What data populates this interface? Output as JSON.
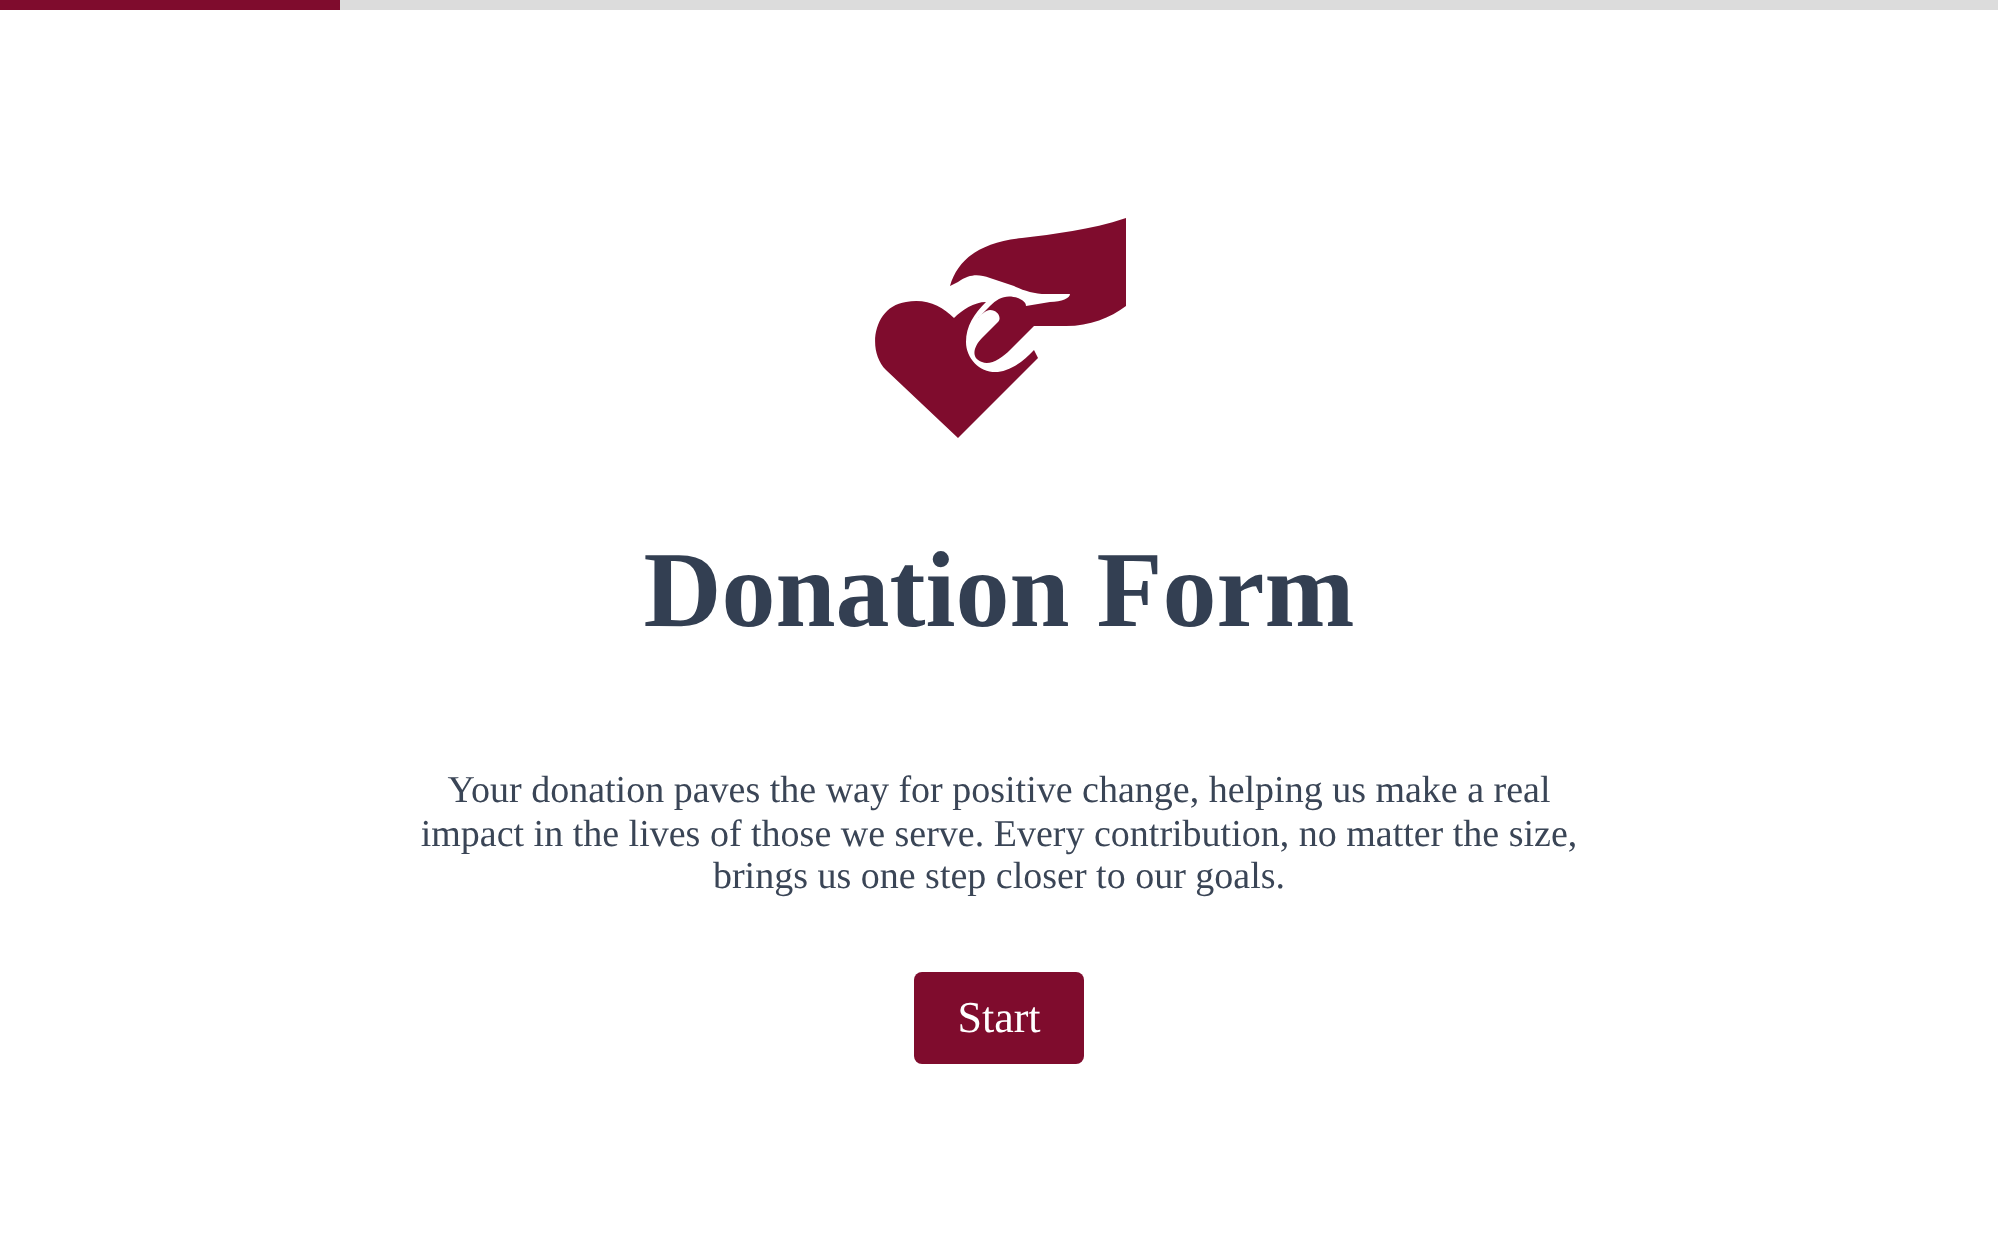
{
  "progress": {
    "level": 0.17
  },
  "title": "Donation Form",
  "description": "Your donation paves the way for positive change, helping us make a real impact in the lives of those we serve. Every contribution, no matter the size, brings us one step closer to our goals.",
  "buttons": [
    {
      "label": "Start"
    }
  ]
}
